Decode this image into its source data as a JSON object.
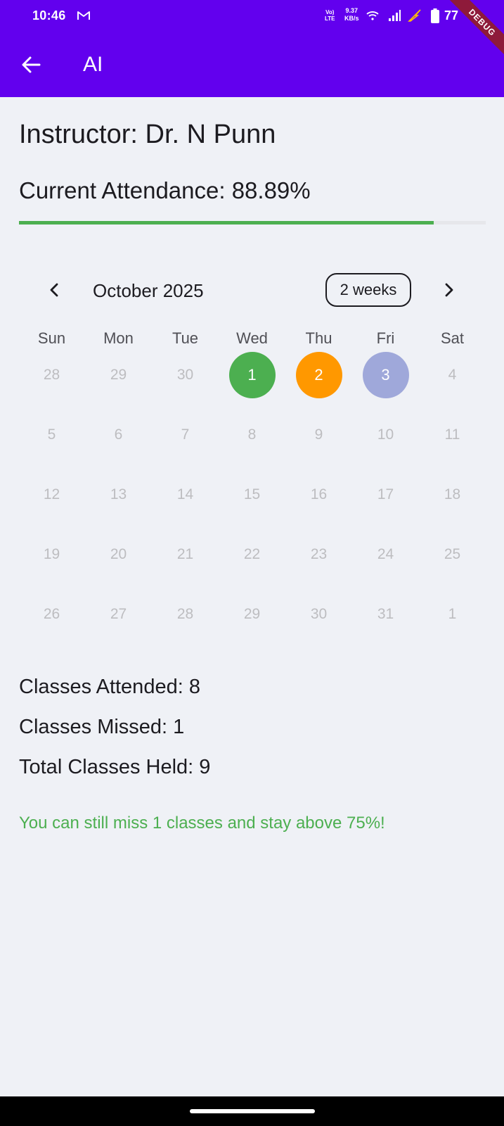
{
  "status_bar": {
    "time": "10:46",
    "volte": "Vo)\nLTE",
    "netspeed_value": "9.37",
    "netspeed_unit": "KB/s",
    "battery": "77"
  },
  "debug_banner": "DEBUG",
  "app_bar": {
    "title": "AI",
    "back_icon": "arrow-left-icon",
    "color": "#6200ee"
  },
  "course": {
    "instructor": "Instructor: Dr. N Punn",
    "attendance_label": "Current Attendance: 88.89%",
    "attendance_percent": 88.89
  },
  "calendar": {
    "month_label": "October 2025",
    "format_button": "2 weeks",
    "weekdays": [
      "Sun",
      "Mon",
      "Tue",
      "Wed",
      "Thu",
      "Fri",
      "Sat"
    ],
    "days": [
      {
        "label": "28"
      },
      {
        "label": "29"
      },
      {
        "label": "30"
      },
      {
        "label": "1",
        "color": "#4caf50"
      },
      {
        "label": "2",
        "color": "#ff9800"
      },
      {
        "label": "3",
        "color": "#9fa8da"
      },
      {
        "label": "4"
      },
      {
        "label": "5"
      },
      {
        "label": "6"
      },
      {
        "label": "7"
      },
      {
        "label": "8"
      },
      {
        "label": "9"
      },
      {
        "label": "10"
      },
      {
        "label": "11"
      },
      {
        "label": "12"
      },
      {
        "label": "13"
      },
      {
        "label": "14"
      },
      {
        "label": "15"
      },
      {
        "label": "16"
      },
      {
        "label": "17"
      },
      {
        "label": "18"
      },
      {
        "label": "19"
      },
      {
        "label": "20"
      },
      {
        "label": "21"
      },
      {
        "label": "22"
      },
      {
        "label": "23"
      },
      {
        "label": "24"
      },
      {
        "label": "25"
      },
      {
        "label": "26"
      },
      {
        "label": "27"
      },
      {
        "label": "28"
      },
      {
        "label": "29"
      },
      {
        "label": "30"
      },
      {
        "label": "31"
      },
      {
        "label": "1"
      }
    ]
  },
  "stats": {
    "attended": "Classes Attended: 8",
    "missed": "Classes Missed: 1",
    "total": "Total Classes Held: 9"
  },
  "advice": "You can still miss 1 classes and stay above 75%!",
  "colors": {
    "progress": "#4caf50",
    "advice": "#4caf50",
    "background": "#eff1f6"
  }
}
